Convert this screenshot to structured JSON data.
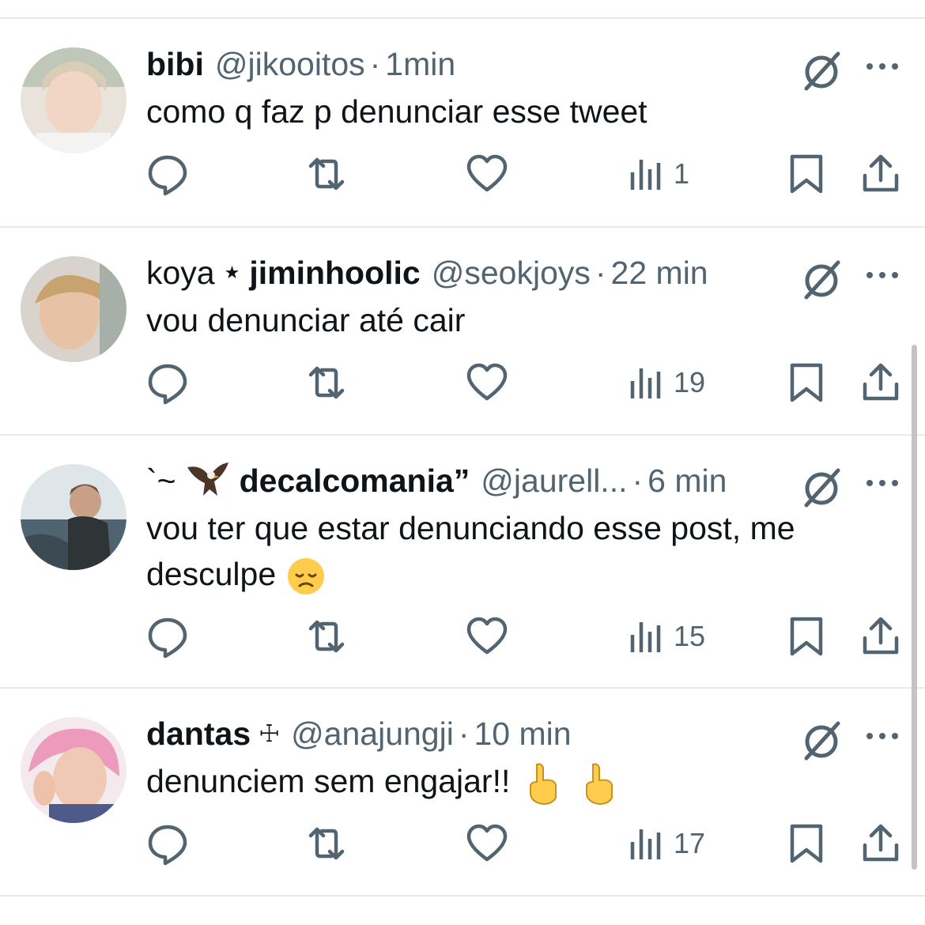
{
  "tweets": [
    {
      "prefix": "",
      "name": "bibi",
      "badge": "",
      "handle": "@jikooitos",
      "time": "1min",
      "text": "como q faz p denunciar esse tweet",
      "views": "1",
      "avatar_color": "#d8cfc4"
    },
    {
      "prefix": "koya",
      "name": "jiminhoolic",
      "badge": "",
      "handle": "@seokjoys",
      "time": "22 min",
      "text": "vou denunciar até cair",
      "views": "19",
      "avatar_color": "#c9a98b"
    },
    {
      "prefix": "`~",
      "name": "decalcomania”",
      "badge": "",
      "handle": "@jaurell...",
      "time": "6 min",
      "text": "vou ter que estar denunciando esse post, me desculpe",
      "views": "15",
      "avatar_color": "#6e8391"
    },
    {
      "prefix": "",
      "name": "dantas",
      "badge": "☩",
      "handle": "@anajungji",
      "time": "10 min",
      "text": "denunciem sem engajar!!",
      "views": "17",
      "avatar_color": "#e7a2bd"
    }
  ],
  "icons": {
    "reply": "reply-icon",
    "retweet": "retweet-icon",
    "like": "heart-icon",
    "views": "views-icon",
    "bookmark": "bookmark-icon",
    "share": "share-icon",
    "grok": "grok-icon",
    "more": "more-icon"
  },
  "colors": {
    "text": "#0f1419",
    "secondary": "#536471",
    "divider": "#e6e9ec"
  }
}
